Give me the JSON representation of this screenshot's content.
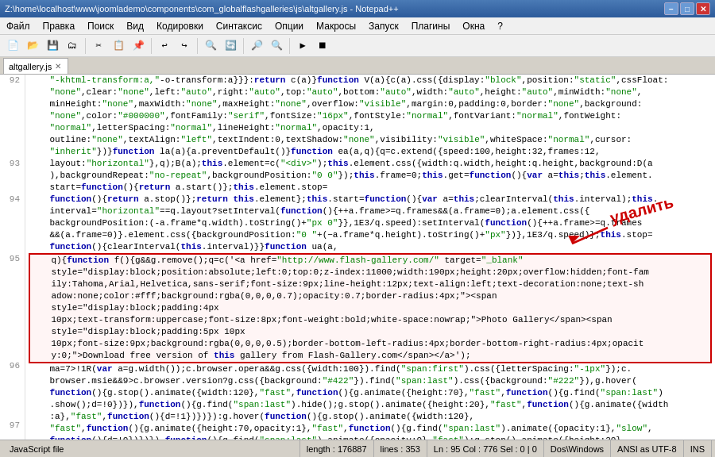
{
  "titleBar": {
    "text": "Z:\\home\\localhost\\www\\joomlademo\\components\\com_globalflashgalleries\\js\\altgallery.js - Notepad++",
    "minimizeLabel": "−",
    "maximizeLabel": "□",
    "closeLabel": "✕"
  },
  "menuBar": {
    "items": [
      "Файл",
      "Правка",
      "Поиск",
      "Вид",
      "Кодировки",
      "Синтаксис",
      "Опции",
      "Макросы",
      "Запуск",
      "Плагины",
      "Окна",
      "?"
    ]
  },
  "tabBar": {
    "tabs": [
      {
        "label": "altgallery.js",
        "active": true
      }
    ]
  },
  "statusBar": {
    "fileType": "JavaScript file",
    "length": "length : 176887",
    "lines": "lines : 353",
    "cursor": "Ln : 95   Col : 776   Sel : 0 | 0",
    "lineEnding": "Dos\\Windows",
    "encoding": "ANSI as UTF-8",
    "mode": "INS"
  },
  "annotation": {
    "text": "удалить"
  },
  "lines": [
    {
      "num": "92",
      "content": "    \"-khtml-transform:a,\"-o-transform:a}}}:return c(a)}function V(a){c(a).css({display:\"block\",position:\"static\",cssFloat:",
      "class": ""
    },
    {
      "num": "",
      "content": "    \"none\",clear:\"none\",left:\"auto\",right:\"auto\",top:\"auto\",bottom:\"auto\",width:\"auto\",height:\"auto\",minWidth:\"none\",",
      "class": ""
    },
    {
      "num": "",
      "content": "    minHeight:\"none\",maxWidth:\"none\",maxHeight:\"none\",overflow:\"visible\",margin:0,padding:0,border:\"none\",background:",
      "class": ""
    },
    {
      "num": "",
      "content": "    \"none\",color:\"#000000\",fontFamily:\"serif\",fontSize:\"16px\",fontStyle:\"normal\",fontVariant:\"normal\",fontWeight:",
      "class": ""
    },
    {
      "num": "",
      "content": "    \"normal\",letterSpacing:\"normal\",lineHeight:\"normal\",opacity:1,",
      "class": ""
    },
    {
      "num": "",
      "content": "    outline:\"none\",textAlign:\"left\",textIndent:0,textShadow:\"none\",visibility:\"visible\",whiteSpace:\"normal\",cursor:",
      "class": ""
    },
    {
      "num": "",
      "content": "    \"inherit\"})}function la(a){a.preventDefault()}function ea(a,q){q=c.extend({speed:100,height:32,frames:12,",
      "class": ""
    },
    {
      "num": "93",
      "content": "    layout:\"horizontal\"},q);B(a);this.element=c(\"<div>\");this.element.css({width:q.width,height:q.height,background:D(a",
      "class": ""
    },
    {
      "num": "",
      "content": "    ),backgroundRepeat:\"no-repeat\",backgroundPosition:\"0 0\"});this.frame=0;this.get=function(){var a=this;this.element.",
      "class": ""
    },
    {
      "num": "",
      "content": "    start=function(){return a.start()};this.element.stop=",
      "class": ""
    },
    {
      "num": "94",
      "content": "    function(){return a.stop()};return this.element};this.start=function(){var a=this;clearInterval(this.interval);this.",
      "class": ""
    },
    {
      "num": "",
      "content": "    interval=\"horizontal\"==q.layout?setInterval(function(){++a.frame>=q.frames&&(a.frame=0);a.element.css({",
      "class": ""
    },
    {
      "num": "",
      "content": "    backgroundPosition:(-a.frame*q.width).toString()+\"px 0\"}},1E3/q.speed):setInterval(function(){++a.frame>=q.frames",
      "class": ""
    },
    {
      "num": "",
      "content": "    &&(a.frame=0)}.element.css({backgroundPosition:\"0 \"+(−a.frame*q.height).toString()+\"px\"})},1E3/q.speed)};this.stop=",
      "class": ""
    },
    {
      "num": "",
      "content": "    function(){clearInterval(this.interval)}}function ua(a,",
      "class": ""
    },
    {
      "num": "95",
      "content": "    q){function f(){g&&g.remove();q=c('<a href=\"http://www.flash-gallery.com/\" target=\"_blank\"",
      "class": "line-95-start"
    },
    {
      "num": "",
      "content": "    style=\"display:block;position:absolute;left:0;top:0;z-index:11000;width:190px;height:20px;overflow:hidden;font-fam",
      "class": "line-95-mid"
    },
    {
      "num": "",
      "content": "    ily:Tahoma,Arial,Helvetica,sans-serif;font-size:9px;line-height:12px;text-align:left;text-decoration:none;text-sh",
      "class": "line-95-mid"
    },
    {
      "num": "",
      "content": "    adow:none;color:#fff;background:rgba(0,0,0,0.7);opacity:0.7;border-radius:4px;\"><span",
      "class": "line-95-mid"
    },
    {
      "num": "",
      "content": "    style=\"display:block;padding:4px",
      "class": "line-95-mid"
    },
    {
      "num": "",
      "content": "    10px;text-transform:uppercase;font-size:8px;font-weight:bold;white-space:nowrap;\">Photo Gallery</span><span",
      "class": "line-95-mid"
    },
    {
      "num": "",
      "content": "    style=\"display:block;padding:5px 10px",
      "class": "line-95-mid"
    },
    {
      "num": "",
      "content": "    10px;font-size:9px;background:rgba(0,0,0,0.5);border-bottom-left-radius:4px;border-bottom-right-radius:4px;opacit",
      "class": "line-95-mid"
    },
    {
      "num": "",
      "content": "    y:0;\">Download free version of this gallery from Flash-Gallery.com</span></a>');",
      "class": "line-95-end"
    },
    {
      "num": "96",
      "content": "    ma=7>!1R(var a=g.width());c.browser.opera&&g.css({width:100}).find(\"span:first\").css({letterSpacing:\"-1px\"});c.",
      "class": ""
    },
    {
      "num": "",
      "content": "    browser.msie&&9>c.browser.version?g.css({background:\"#422\"}).find(\"span:last\").css({background:\"#222\"}),g.hover(",
      "class": ""
    },
    {
      "num": "",
      "content": "    function(){g.stop().animate({width:120},\"fast\",function(){g.animate({height:70},\"fast\",function(){g.find(\"span:last\")",
      "class": ""
    },
    {
      "num": "",
      "content": "    .show();d=!0})}),function(){g.find(\"span:last\").hide();g.stop().animate({height:20},\"fast\",function(){g.animate({width",
      "class": ""
    },
    {
      "num": "",
      "content": "    :a},\"fast\",function(){d=!1})})}):g.hover(function(){g.stop().animate({width:120},",
      "class": ""
    },
    {
      "num": "97",
      "content": "    \"fast\",function(){g.animate({height:70,opacity:1},\"fast\",function(){g.find(\"span:last\").animate({opacity:1},\"slow\",",
      "class": ""
    },
    {
      "num": "",
      "content": "    function(){d=!0})})}),function(){g.find(\"span:last\").animate({opacity:0},\"fast\");g.stop().animate({height:20},",
      "class": ""
    }
  ]
}
